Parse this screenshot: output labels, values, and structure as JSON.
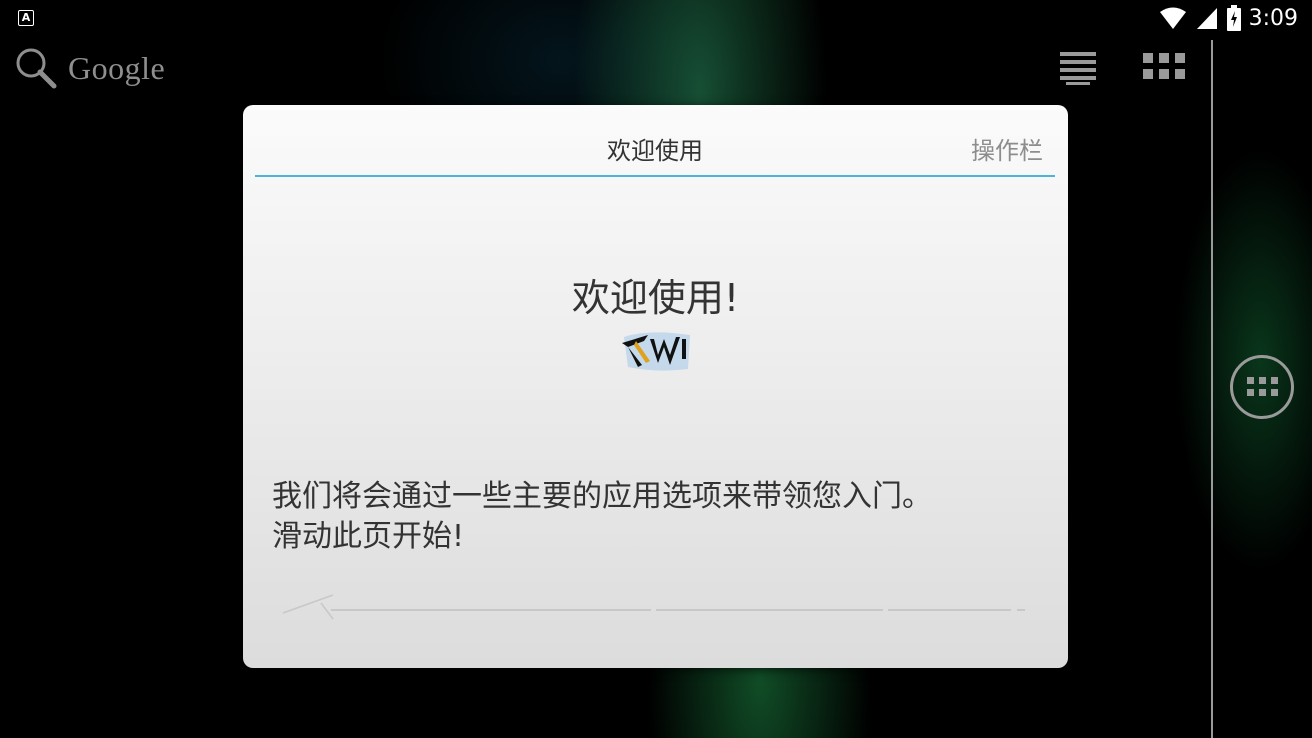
{
  "status_bar": {
    "time": "3:09",
    "icons": [
      "notification-a-icon",
      "wifi-icon",
      "cell-signal-icon",
      "battery-charging-icon"
    ]
  },
  "launcher": {
    "search_label": "Google",
    "icons": [
      "search-icon",
      "voice-list-icon",
      "apps-grid-icon",
      "all-apps-icon"
    ]
  },
  "dialog": {
    "title": "欢迎使用",
    "right_tab": "操作栏",
    "heading": "欢迎使用!",
    "body_lines": [
      "我们将会通过一些主要的应用选项来带领您入门。",
      "滑动此页开始!"
    ],
    "accent_color": "#4fb3d9"
  }
}
